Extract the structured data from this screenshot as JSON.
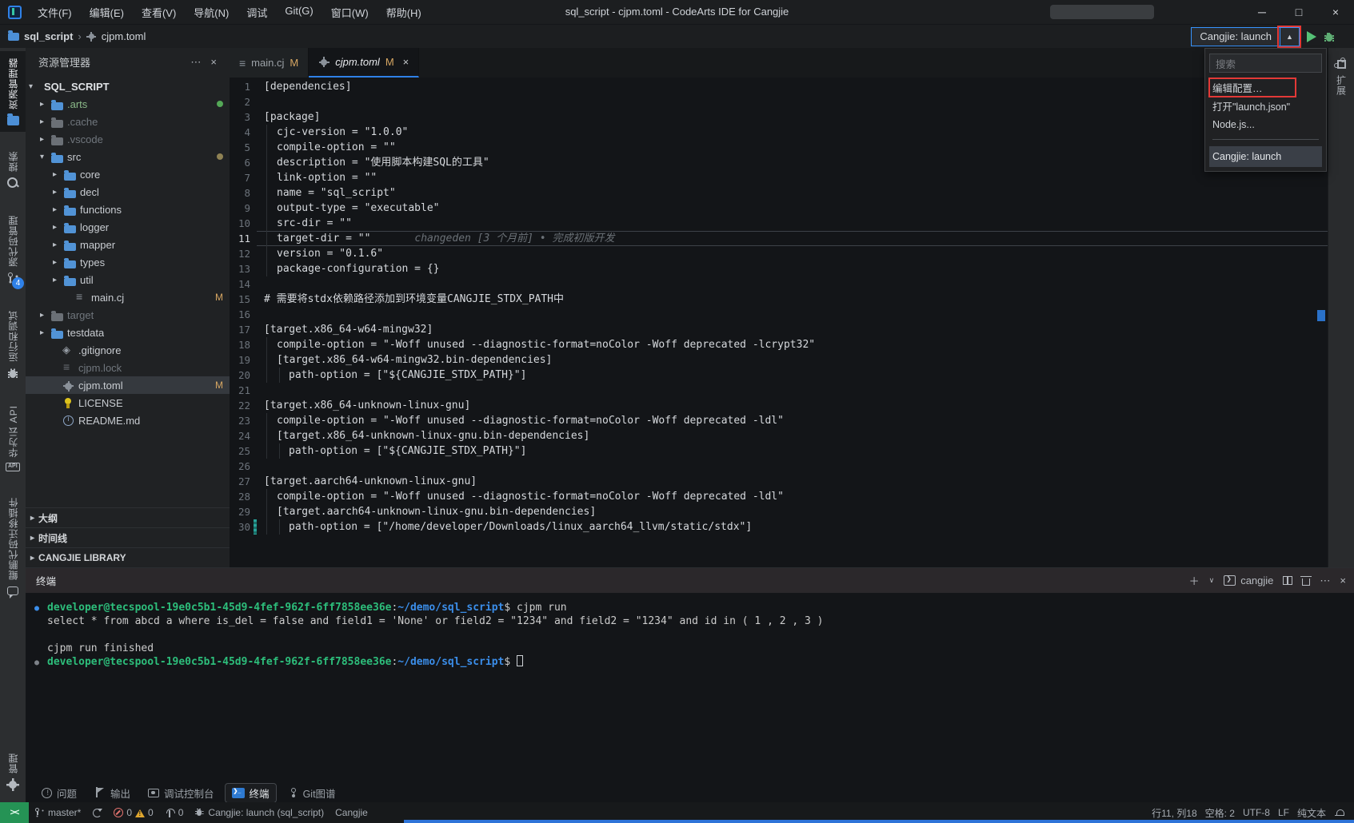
{
  "icons": {
    "close": "×",
    "more": "⋯",
    "plus": "＋",
    "chevron_small_down": "∨",
    "chevron_up": "▲",
    "minimize": "─",
    "maximize": "□",
    "bullet": "●",
    "crumb_sep": "›"
  },
  "title_bar": {
    "menus": [
      "文件(F)",
      "编辑(E)",
      "查看(V)",
      "导航(N)",
      "调试",
      "Git(G)",
      "窗口(W)",
      "帮助(H)"
    ],
    "title": "sql_script - cjpm.toml - CodeArts IDE for Cangjie"
  },
  "breadcrumb": {
    "folder": "sql_script",
    "file": "cjpm.toml"
  },
  "run_bar": {
    "config_label": "Cangjie: launch"
  },
  "dropdown": {
    "search_placeholder": "搜索",
    "items": [
      {
        "label": "编辑配置…",
        "cls": "annotated"
      },
      {
        "label": "打开\"launch.json\"",
        "cls": ""
      },
      {
        "label": "Node.js...",
        "cls": ""
      }
    ],
    "selected": "Cangjie: launch"
  },
  "activity_bar": {
    "items": [
      {
        "label": "资源管理器",
        "icon": "icon-explorer",
        "cls": "active",
        "badge": ""
      },
      {
        "label": "搜索",
        "icon": "icon-search",
        "cls": "",
        "badge": ""
      },
      {
        "label": "源代码管理",
        "icon": "icon-scm",
        "cls": "",
        "badge": "4"
      },
      {
        "label": "运行和调试",
        "icon": "icon-debug",
        "cls": "",
        "badge": ""
      },
      {
        "label": "华为云 API",
        "icon": "icon-api",
        "cls": "",
        "badge": ""
      },
      {
        "label": "鲲鹏代码迁移插件",
        "icon": "icon-kunpeng",
        "cls": "",
        "badge": ""
      }
    ],
    "bottom": {
      "label": "管理",
      "icon": "icon-gearshape"
    },
    "right": {
      "label": "扩展",
      "icon": "icon-ext"
    }
  },
  "sidebar": {
    "header": "资源管理器",
    "tree": [
      {
        "name": "SQL_SCRIPT",
        "pad": "4px",
        "chev": "▾",
        "icon": "",
        "cls": "root"
      },
      {
        "name": ".arts",
        "pad": "18px",
        "chev": "▸",
        "icon": "icon-folder",
        "cls": "green",
        "dot": "#54a857"
      },
      {
        "name": ".cache",
        "pad": "18px",
        "chev": "▸",
        "icon": "icon-folder dim",
        "cls": "dim"
      },
      {
        "name": ".vscode",
        "pad": "18px",
        "chev": "▸",
        "icon": "icon-folder dim",
        "cls": "dim"
      },
      {
        "name": "src",
        "pad": "18px",
        "chev": "▾",
        "icon": "icon-folder",
        "cls": "",
        "dot": "#8f8254"
      },
      {
        "name": "core",
        "pad": "34px",
        "chev": "▸",
        "icon": "icon-folder",
        "cls": ""
      },
      {
        "name": "decl",
        "pad": "34px",
        "chev": "▸",
        "icon": "icon-folder",
        "cls": ""
      },
      {
        "name": "functions",
        "pad": "34px",
        "chev": "▸",
        "icon": "icon-folder",
        "cls": ""
      },
      {
        "name": "logger",
        "pad": "34px",
        "chev": "▸",
        "icon": "icon-folder",
        "cls": ""
      },
      {
        "name": "mapper",
        "pad": "34px",
        "chev": "▸",
        "icon": "icon-folder",
        "cls": ""
      },
      {
        "name": "types",
        "pad": "34px",
        "chev": "▸",
        "icon": "icon-folder",
        "cls": ""
      },
      {
        "name": "util",
        "pad": "34px",
        "chev": "▸",
        "icon": "icon-folder",
        "cls": ""
      },
      {
        "name": "main.cj",
        "pad": "48px",
        "chev": "",
        "icon": "icon-filelines",
        "cls": "",
        "badge": "M"
      },
      {
        "name": "target",
        "pad": "18px",
        "chev": "▸",
        "icon": "icon-folder dim",
        "cls": "dim"
      },
      {
        "name": "testdata",
        "pad": "18px",
        "chev": "▸",
        "icon": "icon-folder",
        "cls": ""
      },
      {
        "name": ".gitignore",
        "pad": "32px",
        "chev": "",
        "icon": "icon-diamond",
        "cls": ""
      },
      {
        "name": "cjpm.lock",
        "pad": "32px",
        "chev": "",
        "icon": "icon-filelines dim",
        "cls": "dim"
      },
      {
        "name": "cjpm.toml",
        "pad": "32px",
        "chev": "",
        "icon": "icon-geartree",
        "cls": "",
        "badge": "M",
        "rowcls": "selected"
      },
      {
        "name": "LICENSE",
        "pad": "32px",
        "chev": "",
        "icon": "icon-license",
        "cls": ""
      },
      {
        "name": "README.md",
        "pad": "32px",
        "chev": "",
        "icon": "icon-info",
        "cls": ""
      }
    ],
    "sections": [
      {
        "label": "大纲"
      },
      {
        "label": "时间线"
      },
      {
        "label": "CANGJIE LIBRARY"
      }
    ]
  },
  "tabs": {
    "items": [
      {
        "name": "main.cj",
        "mod": "M",
        "cls": "inactive",
        "namecls": "",
        "icon": "lines",
        "close": ""
      },
      {
        "name": "cjpm.toml",
        "mod": "M",
        "cls": "active",
        "namecls": "italic",
        "icon": "gear",
        "close": "×"
      }
    ]
  },
  "editor": {
    "lines": [
      {
        "n": "1",
        "text": "[dependencies]",
        "i": 0,
        "pad": "0px"
      },
      {
        "n": "2",
        "text": "",
        "i": 0,
        "pad": "0px"
      },
      {
        "n": "3",
        "text": "[package]",
        "i": 0,
        "pad": "0px"
      },
      {
        "n": "4",
        "text": "cjc-version = \"1.0.0\"",
        "i": 1,
        "pad": "16px"
      },
      {
        "n": "5",
        "text": "compile-option = \"\"",
        "i": 1,
        "pad": "16px"
      },
      {
        "n": "6",
        "text": "description = \"使用脚本构建SQL的工具\"",
        "i": 1,
        "pad": "16px"
      },
      {
        "n": "7",
        "text": "link-option = \"\"",
        "i": 1,
        "pad": "16px"
      },
      {
        "n": "8",
        "text": "name = \"sql_script\"",
        "i": 1,
        "pad": "16px"
      },
      {
        "n": "9",
        "text": "output-type = \"executable\"",
        "i": 1,
        "pad": "16px"
      },
      {
        "n": "10",
        "text": "src-dir = \"\"",
        "i": 1,
        "pad": "16px"
      },
      {
        "n": "11",
        "text": "target-dir = \"\"",
        "i": 1,
        "pad": "16px",
        "rowcls": "cur",
        "blame": "changeden [3 个月前] • 完成初版开发"
      },
      {
        "n": "12",
        "text": "version = \"0.1.6\"",
        "i": 1,
        "pad": "16px"
      },
      {
        "n": "13",
        "text": "package-configuration = {}",
        "i": 1,
        "pad": "16px"
      },
      {
        "n": "14",
        "text": "",
        "i": 0,
        "pad": "0px"
      },
      {
        "n": "15",
        "text": "# 需要将stdx依赖路径添加到环境变量CANGJIE_STDX_PATH中",
        "i": 0,
        "pad": "0px"
      },
      {
        "n": "16",
        "text": "",
        "i": 0,
        "pad": "0px"
      },
      {
        "n": "17",
        "text": "[target.x86_64-w64-mingw32]",
        "i": 0,
        "pad": "0px"
      },
      {
        "n": "18",
        "text": "compile-option = \"-Woff unused --diagnostic-format=noColor -Woff deprecated -lcrypt32\"",
        "i": 1,
        "pad": "16px"
      },
      {
        "n": "19",
        "text": "[target.x86_64-w64-mingw32.bin-dependencies]",
        "i": 1,
        "pad": "16px"
      },
      {
        "n": "20",
        "text": "path-option = [\"${CANGJIE_STDX_PATH}\"]",
        "i": 2,
        "pad": "31px"
      },
      {
        "n": "21",
        "text": "",
        "i": 0,
        "pad": "0px"
      },
      {
        "n": "22",
        "text": "[target.x86_64-unknown-linux-gnu]",
        "i": 0,
        "pad": "0px"
      },
      {
        "n": "23",
        "text": "compile-option = \"-Woff unused --diagnostic-format=noColor -Woff deprecated -ldl\"",
        "i": 1,
        "pad": "16px"
      },
      {
        "n": "24",
        "text": "[target.x86_64-unknown-linux-gnu.bin-dependencies]",
        "i": 1,
        "pad": "16px"
      },
      {
        "n": "25",
        "text": "path-option = [\"${CANGJIE_STDX_PATH}\"]",
        "i": 2,
        "pad": "31px"
      },
      {
        "n": "26",
        "text": "",
        "i": 0,
        "pad": "0px"
      },
      {
        "n": "27",
        "text": "[target.aarch64-unknown-linux-gnu]",
        "i": 0,
        "pad": "0px"
      },
      {
        "n": "28",
        "text": "compile-option = \"-Woff unused --diagnostic-format=noColor -Woff deprecated -ldl\"",
        "i": 1,
        "pad": "16px"
      },
      {
        "n": "29",
        "text": "[target.aarch64-unknown-linux-gnu.bin-dependencies]",
        "i": 1,
        "pad": "16px"
      },
      {
        "n": "30",
        "text": "path-option = [\"/home/developer/Downloads/linux_aarch64_llvm/static/stdx\"]",
        "i": 2,
        "pad": "31px",
        "gutter": "on"
      }
    ]
  },
  "panel": {
    "title": "终端",
    "instance": "cangjie"
  },
  "terminal": {
    "lines": [
      {
        "bullet": "blue",
        "segments": [
          {
            "cls": "g",
            "text": "developer@tecspool-19e0c5b1-45d9-4fef-962f-6ff7858ee36e"
          },
          {
            "cls": "d",
            "text": ":"
          },
          {
            "cls": "b",
            "text": "~/demo/sql_script"
          },
          {
            "cls": "d",
            "text": "$ cjpm run"
          }
        ]
      },
      {
        "segments": [
          {
            "cls": "d",
            "text": "select * from abcd a where is_del = false and field1 = 'None' or field2 = \"1234\" and field2 = \"1234\" and id in ( 1 , 2 , 3 )"
          }
        ]
      },
      {
        "segments": []
      },
      {
        "segments": [
          {
            "cls": "d",
            "text": "cjpm run finished"
          }
        ]
      },
      {
        "bullet": "gray",
        "cursor": true,
        "segments": [
          {
            "cls": "g",
            "text": "developer@tecspool-19e0c5b1-45d9-4fef-962f-6ff7858ee36e"
          },
          {
            "cls": "d",
            "text": ":"
          },
          {
            "cls": "b",
            "text": "~/demo/sql_script"
          },
          {
            "cls": "d",
            "text": "$ "
          }
        ]
      }
    ]
  },
  "panel_tabs": {
    "items": [
      {
        "label": "问题",
        "icon": "icon-problems",
        "cls": ""
      },
      {
        "label": "输出",
        "icon": "icon-flag",
        "cls": ""
      },
      {
        "label": "调试控制台",
        "icon": "icon-dbgconsole",
        "cls": ""
      },
      {
        "label": "终端",
        "icon": "icon-termtab",
        "cls": "active"
      },
      {
        "label": "Git图谱",
        "icon": "icon-gitgraph",
        "cls": ""
      }
    ]
  },
  "status_bar": {
    "branch": "master*",
    "errors": "0",
    "warnings": "0",
    "ports": "0",
    "launch": "Cangjie: launch (sql_script)",
    "lang_ctx": "Cangjie",
    "cursor_pos": "行11, 列18",
    "indent": "空格: 2",
    "encoding": "UTF-8",
    "eol": "LF",
    "mode": "纯文本"
  }
}
